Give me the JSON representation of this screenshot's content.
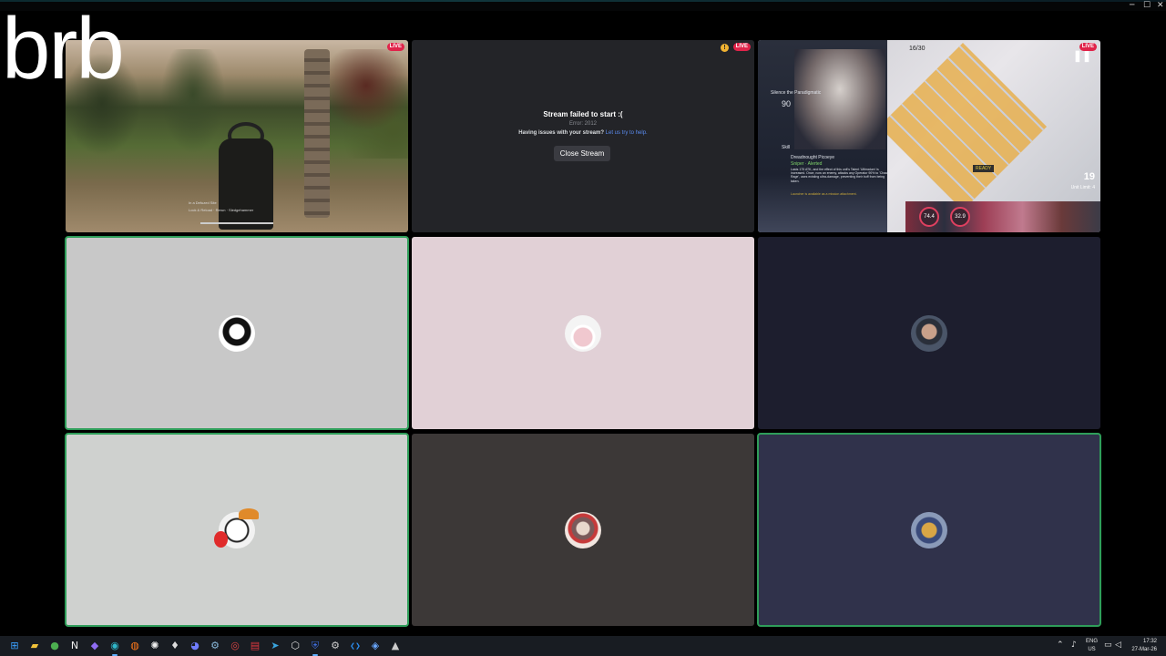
{
  "overlay_text": "brb",
  "window_controls": {
    "minimize": "─",
    "maximize": "☐",
    "close": "✕"
  },
  "live_badge": "LIVE",
  "warning_icon": "!",
  "stream_error": {
    "title": "Stream failed to start :(",
    "error_code": "Error: 2012",
    "help_text": "Having issues with your stream?",
    "help_link": "Let us try to help.",
    "close_button": "Close Stream"
  },
  "game1_hud": {
    "status_line_1": "In a Defuzed Site",
    "status_line_2": "Lock & Reload · Rerun · Sledgehammer"
  },
  "game3_hud": {
    "wave": "16/30",
    "stage_title": "Silence the Paradigmatic",
    "level": "90",
    "skill_label": "Skill",
    "operator_name": "Dreadnought Picoeye",
    "operator_tags": "Sniper · Alerted",
    "description": "Lasts 175 ATK, and the effect of this unit's Talent 'Ultimatum' is increased. Once, now an enemy, attacks any Operator 90% to 'Chaos Rage', uses existing ultra-damage, preventing their buff from being taken.",
    "footer_note": "Launcher is available as a mission attachment.",
    "ready": "READY",
    "deploy_cost": "19",
    "unit_limit": "Unit Limit: 4",
    "timer_a": "74.4",
    "timer_b": "32.9"
  },
  "taskbar": {
    "icons": [
      {
        "name": "windows-start-icon",
        "glyph": "⊞",
        "color": "#3aa0ff"
      },
      {
        "name": "file-explorer-icon",
        "glyph": "▰",
        "color": "#f2c23a"
      },
      {
        "name": "chrome-icon",
        "glyph": "●",
        "color": "#4caf50"
      },
      {
        "name": "notion-icon",
        "glyph": "N",
        "color": "#eeeeee"
      },
      {
        "name": "obsidian-icon",
        "glyph": "◆",
        "color": "#8e6cf2"
      },
      {
        "name": "edge-icon",
        "glyph": "◉",
        "color": "#2fb7c9"
      },
      {
        "name": "firefox-icon",
        "glyph": "◍",
        "color": "#ff7a1a"
      },
      {
        "name": "chatgpt-icon",
        "glyph": "✺",
        "color": "#eeeeee"
      },
      {
        "name": "vencord-icon",
        "glyph": "♦",
        "color": "#dddddd"
      },
      {
        "name": "discord-icon",
        "glyph": "◕",
        "color": "#6f7cff"
      },
      {
        "name": "steam-icon",
        "glyph": "⚙",
        "color": "#88b6d8"
      },
      {
        "name": "chrome-alt-icon",
        "glyph": "◎",
        "color": "#d44"
      },
      {
        "name": "app-red-icon",
        "glyph": "▤",
        "color": "#e0383e"
      },
      {
        "name": "telegram-icon",
        "glyph": "➤",
        "color": "#3aa6e0"
      },
      {
        "name": "unity-icon",
        "glyph": "⬡",
        "color": "#dddddd"
      },
      {
        "name": "bitwarden-icon",
        "glyph": "⛨",
        "color": "#3d6bd8"
      },
      {
        "name": "settings-icon",
        "glyph": "⚙",
        "color": "#cccccc"
      },
      {
        "name": "vscode-icon",
        "glyph": "❮❯",
        "color": "#2a8ff2"
      },
      {
        "name": "app-blue-icon",
        "glyph": "◈",
        "color": "#6aa8ff"
      },
      {
        "name": "arknights-icon",
        "glyph": "▲",
        "color": "#cccccc"
      }
    ],
    "tray": {
      "lang_top": "ENG",
      "lang_bottom": "US",
      "time": "17:32",
      "date": "27-Mar-26"
    }
  },
  "colors": {
    "live_red": "#e0244a",
    "speaking_green": "#2f9e5a",
    "link_blue": "#5b8cf0"
  }
}
